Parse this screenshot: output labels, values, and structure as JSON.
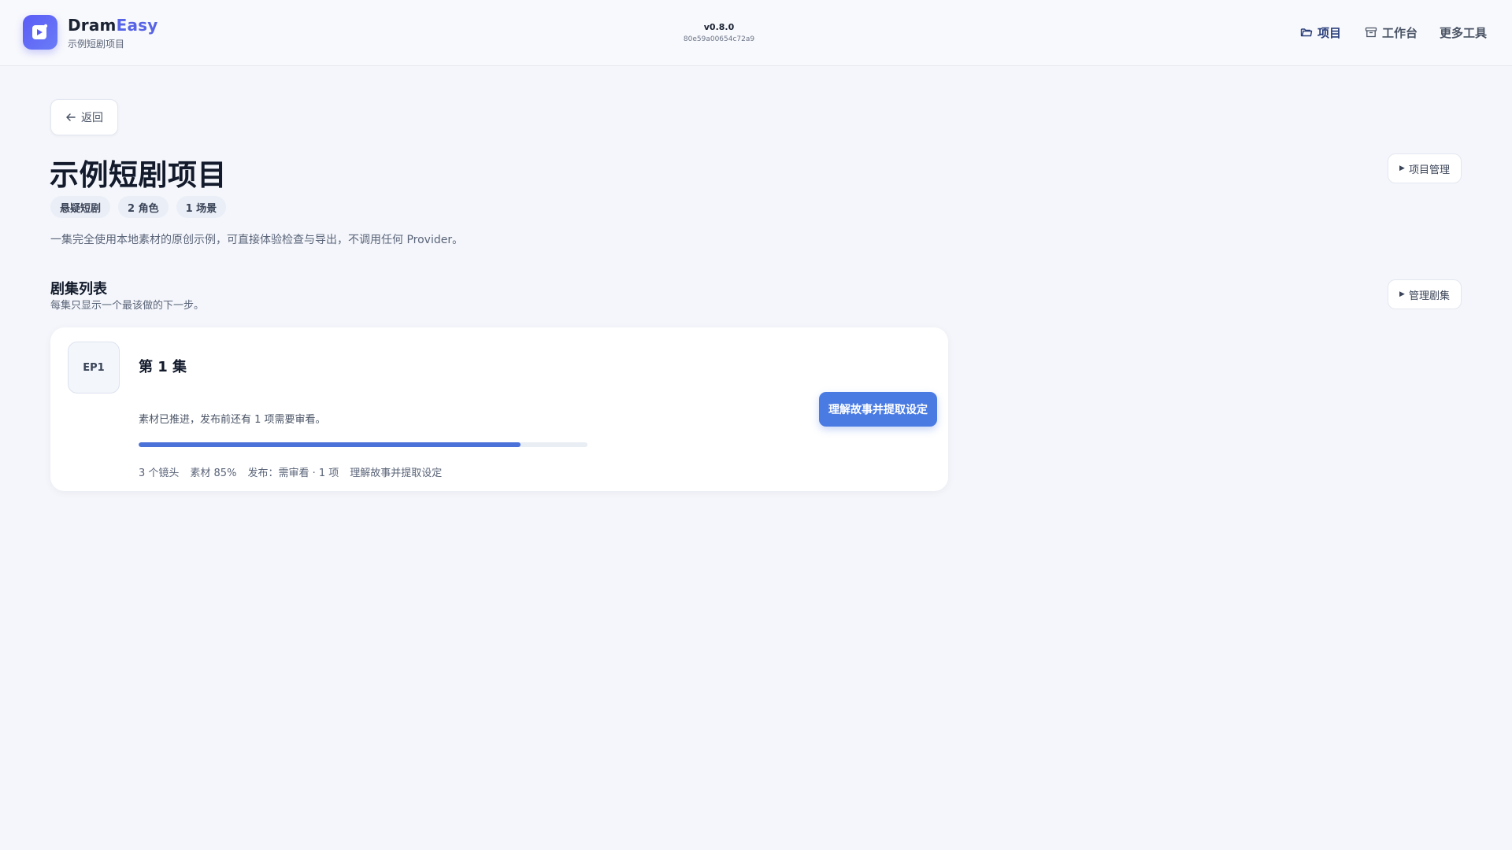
{
  "header": {
    "brand_part1": "Dram",
    "brand_part2": "Easy",
    "brand_sub": "示例短剧项目",
    "version": "v0.8.0",
    "commit": "80e59a00654c72a9",
    "nav": {
      "projects": "项目",
      "workbench": "工作台",
      "more_tools": "更多工具"
    },
    "icons": {
      "logo": "play-sparkle-icon",
      "projects": "folder-icon",
      "workbench": "archive-box-icon"
    }
  },
  "page": {
    "back_label": "返回",
    "title": "示例短剧项目",
    "tags": [
      "悬疑短剧",
      "2 角色",
      "1 场景"
    ],
    "description": "一集完全使用本地素材的原创示例，可直接体验检查与导出，不调用任何 Provider。",
    "project_mgmt_label": "项目管理",
    "episode_mgmt_label": "管理剧集"
  },
  "episodes_section": {
    "title": "剧集列表",
    "subtitle": "每集只显示一个最该做的下一步。",
    "episodes": [
      {
        "badge": "EP1",
        "title": "第 1 集",
        "status": "素材已推进，发布前还有 1 项需要审看。",
        "progress_percent": 85,
        "meta": [
          "3 个镜头",
          "素材 85%",
          "发布：需审看 · 1 项",
          "理解故事并提取设定"
        ],
        "action_label": "理解故事并提取设定"
      }
    ]
  },
  "colors": {
    "accent": "#4a7be2",
    "brand_accent": "#5864e6",
    "progress": "#4a72d9",
    "background": "#f4f6fb"
  }
}
